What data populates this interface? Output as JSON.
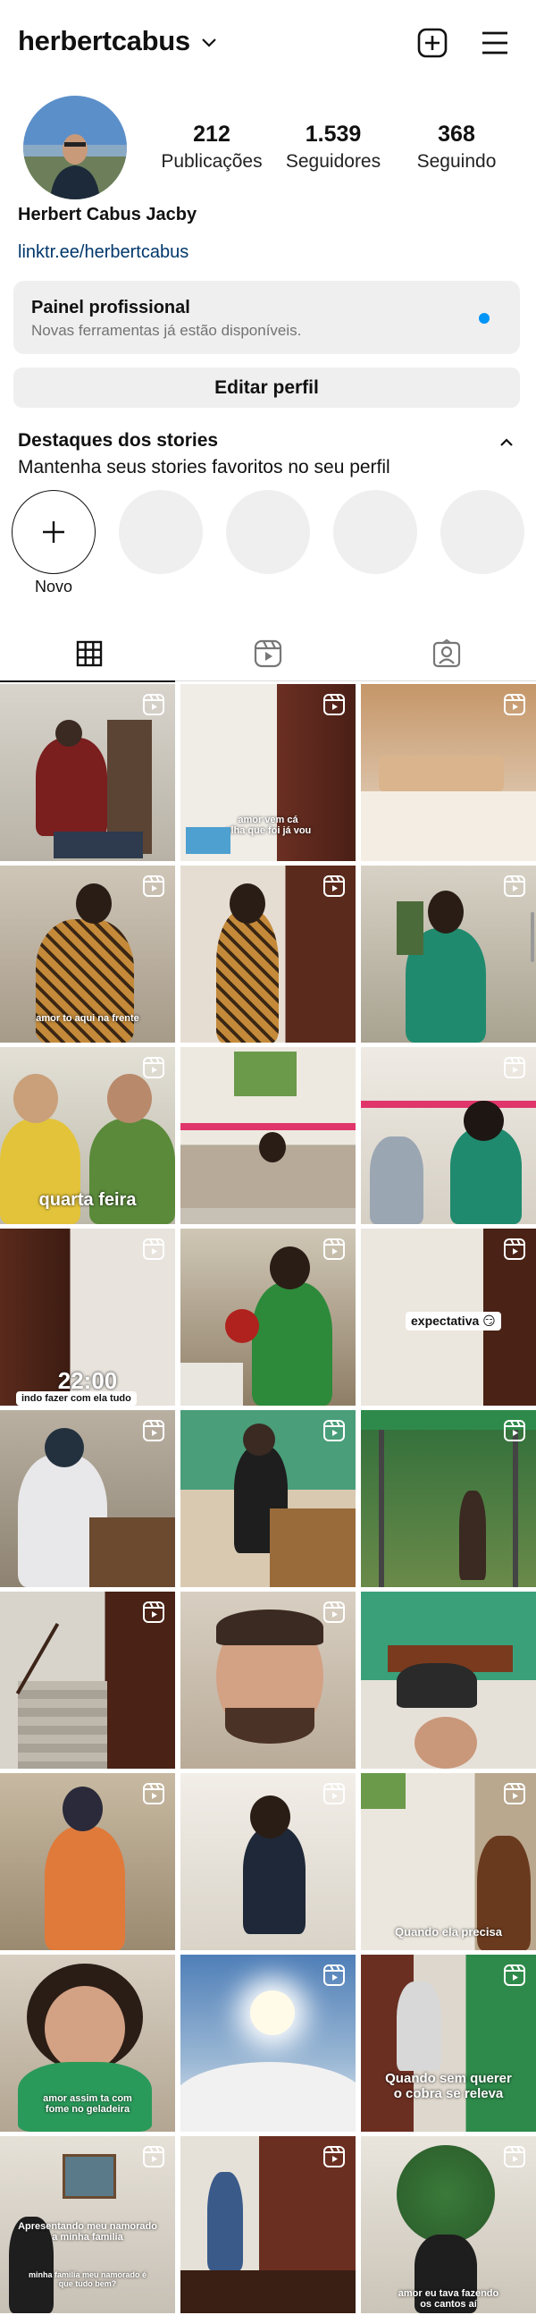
{
  "header": {
    "username": "herbertcabus",
    "icons": [
      "chevron-down-icon",
      "new-post-icon",
      "menu-icon"
    ]
  },
  "profile": {
    "stats": [
      {
        "value": "212",
        "label": "Publicações"
      },
      {
        "value": "1.539",
        "label": "Seguidores"
      },
      {
        "value": "368",
        "label": "Seguindo"
      }
    ],
    "full_name": "Herbert Cabus Jacby",
    "link": "linktr.ee/herbertcabus"
  },
  "pro_panel": {
    "title": "Painel profissional",
    "subtitle": "Novas ferramentas já estão disponíveis."
  },
  "edit_profile_label": "Editar perfil",
  "highlights": {
    "title": "Destaques dos stories",
    "subtitle": "Mantenha seus stories favoritos no seu perfil",
    "new_label": "Novo"
  },
  "tabs": [
    "grid-icon",
    "reels-icon",
    "tagged-icon"
  ],
  "posts": {
    "captions": {
      "p2": "amor vem cá\nolha que foi já vou",
      "p4": "amor to aqui na frente",
      "p7": "quarta feira",
      "p10_time": "22:00",
      "p10_sub": "indo fazer com ela tudo",
      "p12": "expectativa 😏",
      "p21": "Quando ela precisa",
      "p22": "amor assim ta com\nfome no geladeira",
      "p24": "Quando sem querer\no cobra se releva",
      "p25": "Apresentando meu namorado\na minha familia",
      "p25b": "minha familia meu namorado é\nque tudo bem?",
      "p27": "amor eu tava fazendo\nos cantos aí"
    }
  }
}
